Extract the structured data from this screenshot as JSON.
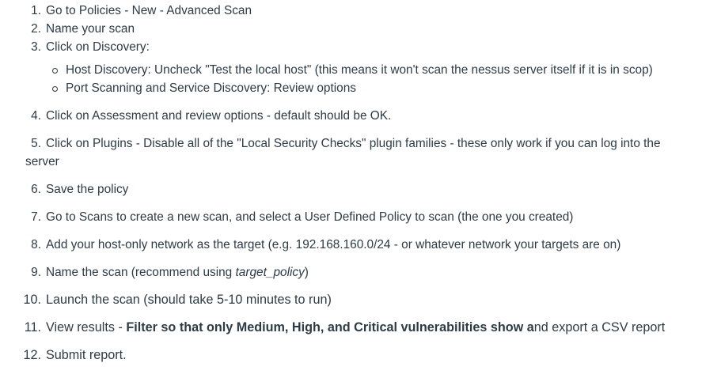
{
  "steps": [
    {
      "num": "1.",
      "text": "Go to Policies - New - Advanced Scan"
    },
    {
      "num": "2.",
      "text": "Name your scan"
    },
    {
      "num": "3.",
      "text": "Click on Discovery:"
    },
    {
      "num": "4.",
      "text": "Click on Assessment and review options - default should be OK."
    },
    {
      "num": "5.",
      "text": "Click on Plugins - Disable all of the \"Local Security Checks\" plugin families - these only work if you can log into the",
      "cont": "server"
    },
    {
      "num": "6.",
      "text": "Save the policy"
    },
    {
      "num": "7.",
      "text": "Go to Scans to create a new scan, and select a User Defined Policy to scan (the one you created)"
    },
    {
      "num": "8.",
      "text": "Add your host-only network as the target (e.g. 192.168.160.0/24 - or whatever network your targets are on)"
    },
    {
      "num": "9.",
      "text": "Name the scan (recommend using ",
      "italic": "target_policy",
      "after": ")"
    },
    {
      "num": "10.",
      "text": "Launch the scan (should take 5-10 minutes to run)"
    },
    {
      "num": "11.",
      "text": "View results - ",
      "bold": "Filter so that only Medium, High, and Critical vulnerabilities show a",
      "after": "nd export a CSV report"
    },
    {
      "num": "12.",
      "text": "Submit report."
    }
  ],
  "discovery_subitems": [
    "Host Discovery: Uncheck \"Test the local host\" (this means it won't scan the nessus server itself if it is in scop)",
    "Port Scanning and Service Discovery: Review options"
  ]
}
